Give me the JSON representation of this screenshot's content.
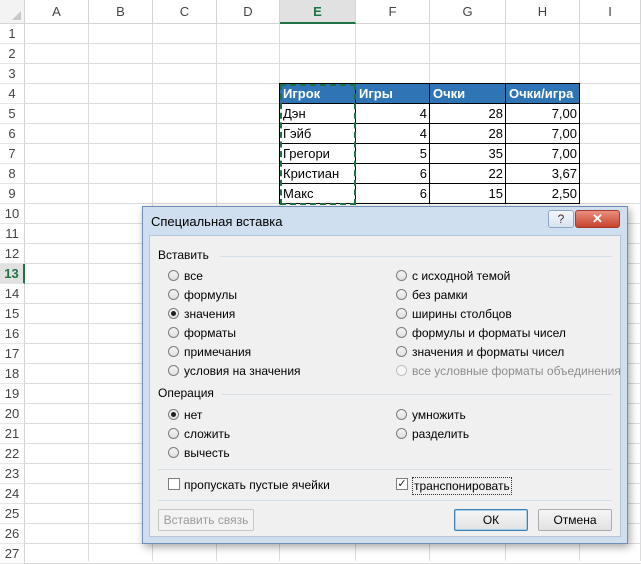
{
  "sheet": {
    "columns": [
      "A",
      "B",
      "C",
      "D",
      "E",
      "F",
      "G",
      "H",
      "I"
    ],
    "active_column": "E",
    "rows": [
      "1",
      "2",
      "3",
      "4",
      "5",
      "6",
      "7",
      "8",
      "9",
      "10",
      "11",
      "12",
      "13",
      "14",
      "15",
      "16",
      "17",
      "18",
      "19",
      "20",
      "21",
      "22",
      "23",
      "24",
      "25",
      "26",
      "27"
    ],
    "active_row": "13",
    "table": {
      "headers": [
        "Игрок",
        "Игры",
        "Очки",
        "Очки/игра"
      ],
      "rows": [
        [
          "Дэн",
          "4",
          "28",
          "7,00"
        ],
        [
          "Гэйб",
          "4",
          "28",
          "7,00"
        ],
        [
          "Грегори",
          "5",
          "35",
          "7,00"
        ],
        [
          "Кристиан",
          "6",
          "22",
          "3,67"
        ],
        [
          "Макс",
          "6",
          "15",
          "2,50"
        ]
      ]
    },
    "colors": {
      "header_fill": "#2f75b5",
      "header_text": "#ffffff",
      "selection_accent": "#217346"
    }
  },
  "dialog": {
    "title": "Специальная вставка",
    "help_label": "?",
    "close_label": "✕",
    "paste_group": "Вставить",
    "paste_left": [
      "все",
      "формулы",
      "значения",
      "форматы",
      "примечания",
      "условия на значения"
    ],
    "paste_right": [
      "с исходной темой",
      "без рамки",
      "ширины столбцов",
      "формулы и форматы чисел",
      "значения и форматы чисел",
      "все условные форматы объединения"
    ],
    "paste_selected": "значения",
    "operation_group": "Операция",
    "operation_left": [
      "нет",
      "сложить",
      "вычесть"
    ],
    "operation_right": [
      "умножить",
      "разделить"
    ],
    "operation_selected": "нет",
    "skip_blanks_label": "пропускать пустые ячейки",
    "skip_blanks_checked": false,
    "transpose_label": "транспонировать",
    "transpose_checked": true,
    "paste_link_label": "Вставить связь",
    "ok_label": "ОК",
    "cancel_label": "Отмена"
  }
}
